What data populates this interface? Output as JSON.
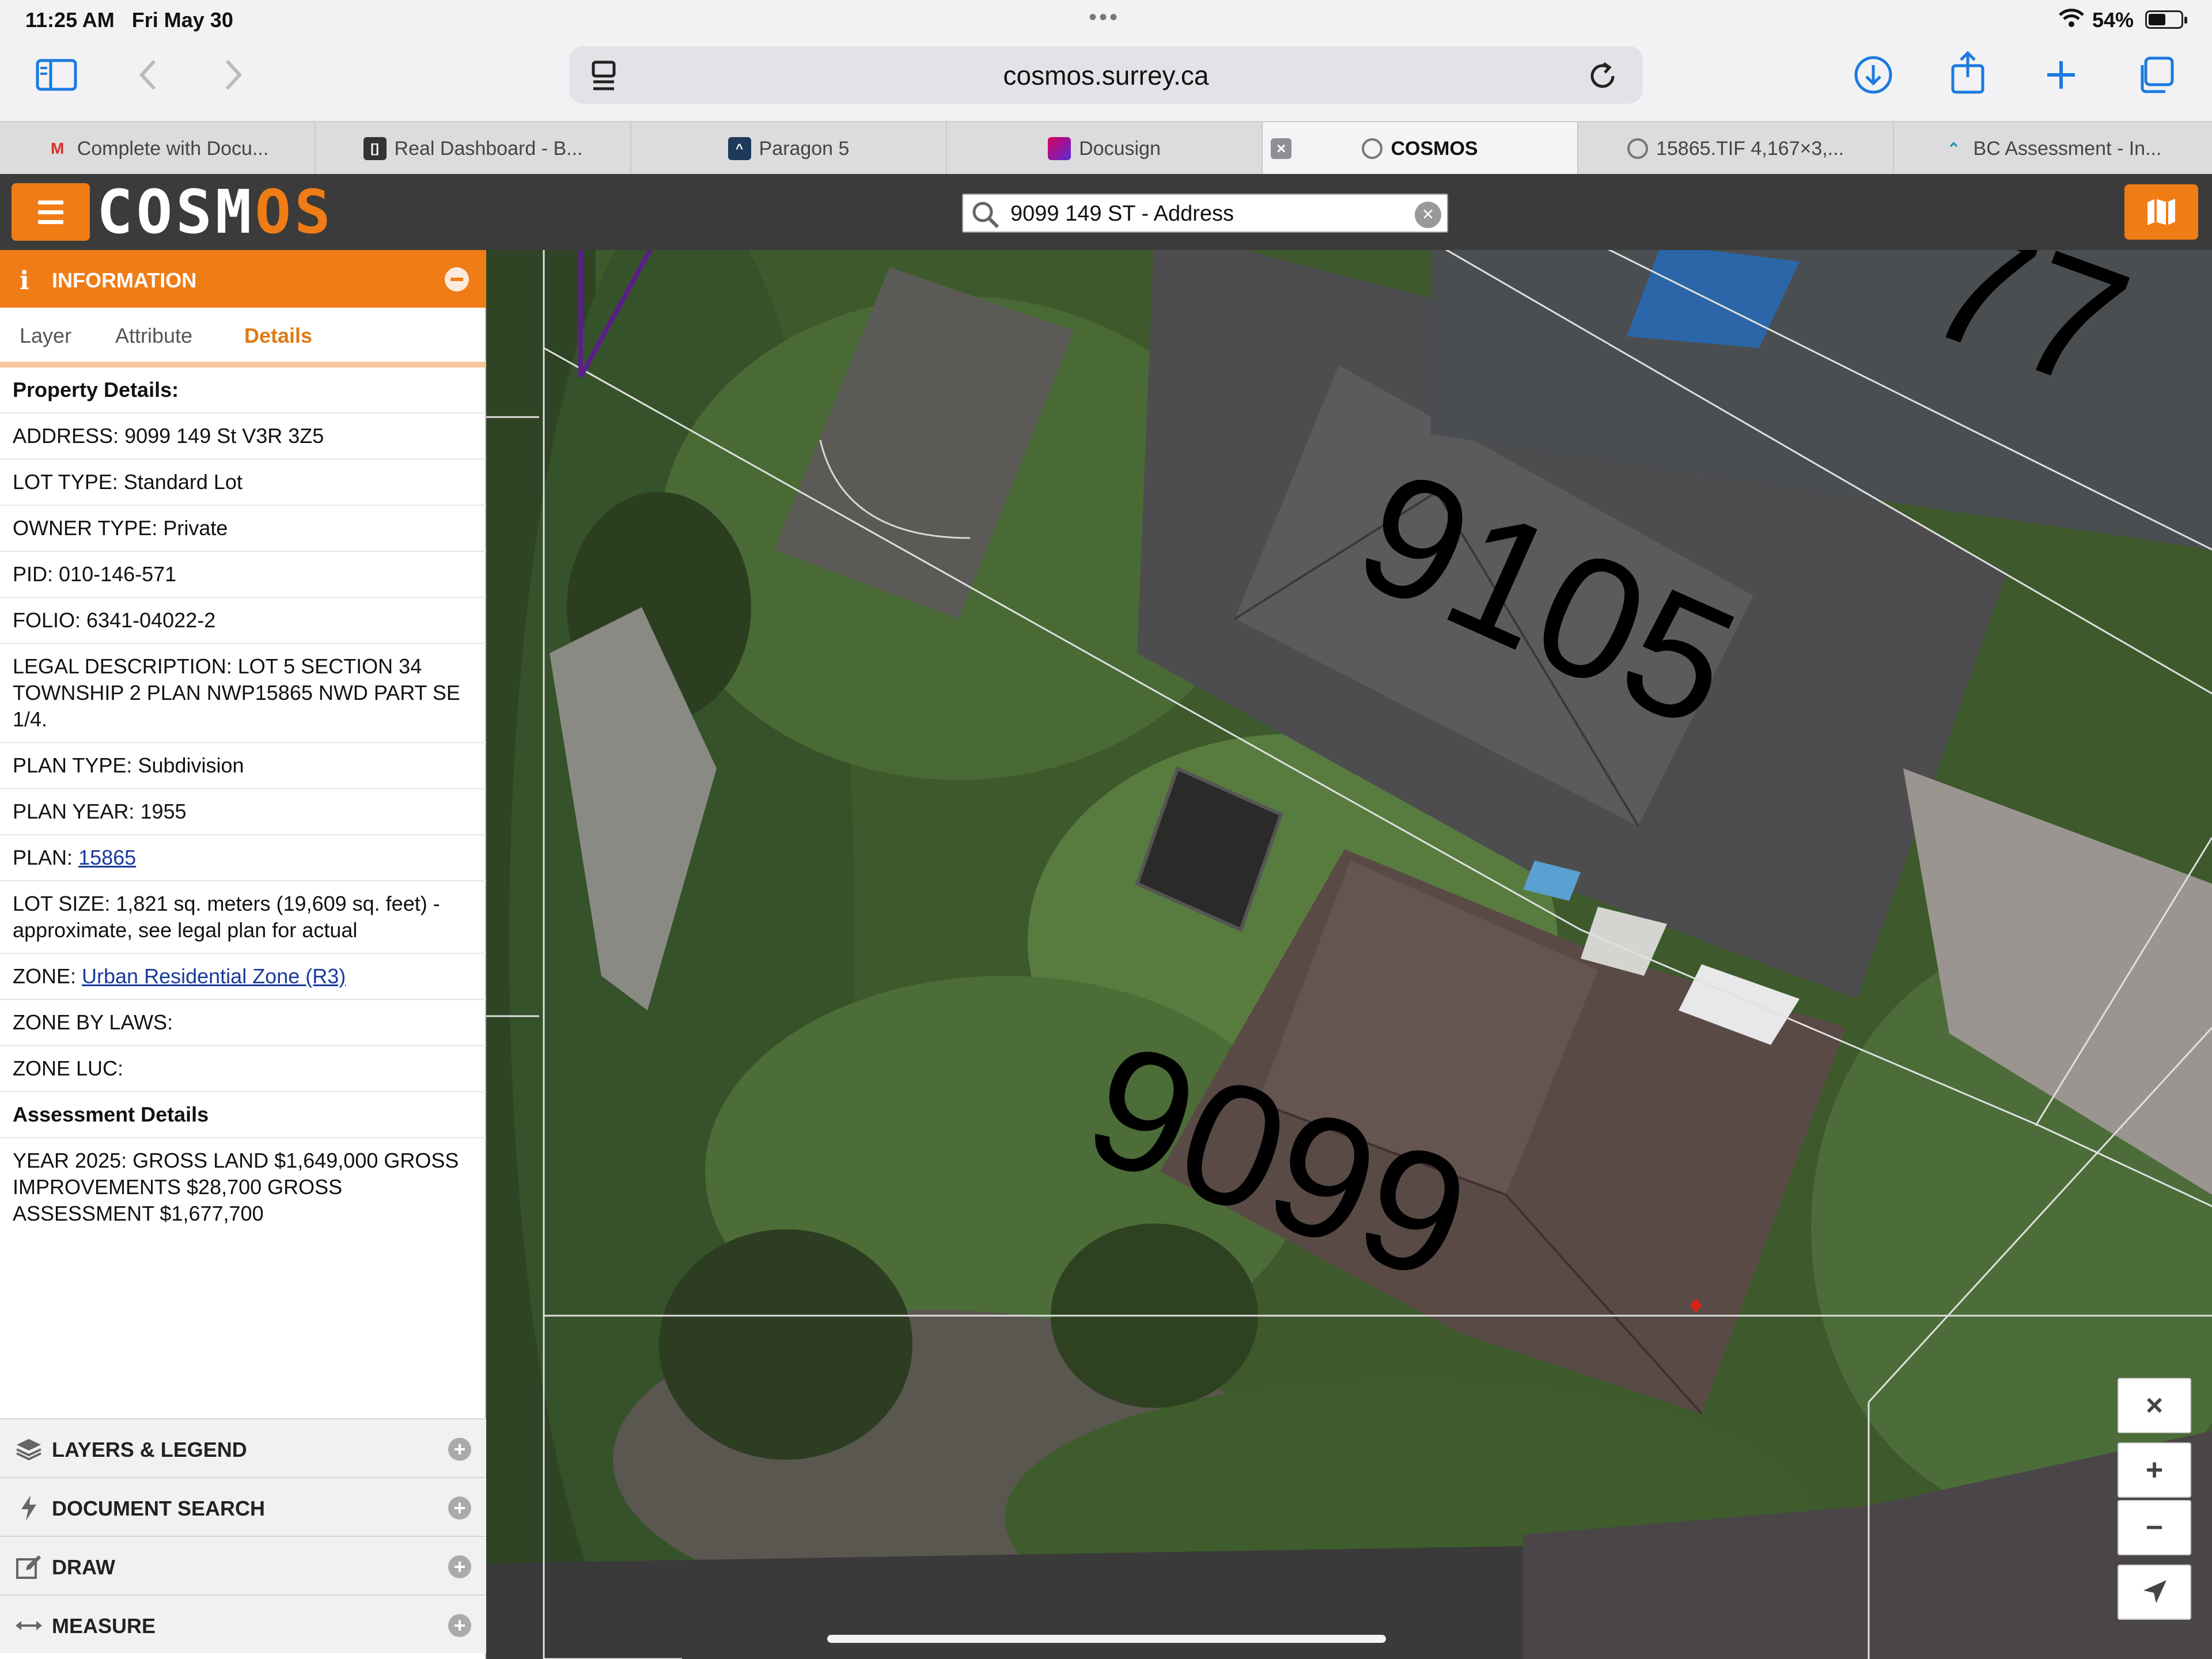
{
  "status_bar": {
    "time": "11:25 AM",
    "date": "Fri May 30",
    "battery_percent": "54%",
    "battery_level": 0.54
  },
  "browser": {
    "url": "cosmos.surrey.ca",
    "tabs": [
      {
        "label": "Complete with Docu...",
        "icon": "gmail-icon"
      },
      {
        "label": "Real Dashboard - B...",
        "icon": "dashboard-icon"
      },
      {
        "label": "Paragon 5",
        "icon": "paragon-icon"
      },
      {
        "label": "Docusign",
        "icon": "docusign-icon"
      },
      {
        "label": "COSMOS",
        "icon": "cosmos-icon",
        "active": true
      },
      {
        "label": "15865.TIF 4,167×3,...",
        "icon": "cosmos-icon"
      },
      {
        "label": "BC Assessment - In...",
        "icon": "bc-assessment-icon"
      }
    ]
  },
  "app": {
    "logo_parts": [
      "COSM",
      "O",
      "S"
    ],
    "search_value": "9099 149 ST - Address",
    "accent_color": "#f07c16"
  },
  "sidebar": {
    "info_title": "INFORMATION",
    "tabs": [
      "Layer",
      "Attribute",
      "Details"
    ],
    "active_tab": "Details",
    "property_heading": "Property Details",
    "rows": [
      {
        "label": "ADDRESS:",
        "value": "9099 149 St V3R 3Z5"
      },
      {
        "label": "LOT TYPE:",
        "value": "Standard Lot"
      },
      {
        "label": "OWNER TYPE:",
        "value": "Private"
      },
      {
        "label": "PID:",
        "value": "010-146-571"
      },
      {
        "label": "FOLIO:",
        "value": "6341-04022-2"
      },
      {
        "label": "LEGAL DESCRIPTION:",
        "value": "LOT 5 SECTION 34 TOWNSHIP 2 PLAN NWP15865 NWD PART SE 1/4."
      },
      {
        "label": "PLAN TYPE:",
        "value": "Subdivision"
      },
      {
        "label": "PLAN YEAR:",
        "value": "1955"
      },
      {
        "label": "PLAN:",
        "value": "15865",
        "link": true
      },
      {
        "label": "LOT SIZE:",
        "value": "1,821 sq. meters (19,609 sq. feet) - approximate, see legal plan for actual"
      },
      {
        "label": "ZONE:",
        "value": "Urban Residential Zone (R3)",
        "link": true
      },
      {
        "label": "ZONE BY LAWS:",
        "value": ""
      },
      {
        "label": "ZONE LUC:",
        "value": ""
      }
    ],
    "assessment_heading": "Assessment Details",
    "assessment_text": "YEAR 2025: GROSS LAND $1,649,000 GROSS IMPROVEMENTS $28,700 GROSS ASSESSMENT $1,677,700",
    "accordions": [
      {
        "label": "LAYERS & LEGEND",
        "icon": "layers-icon"
      },
      {
        "label": "DOCUMENT SEARCH",
        "icon": "bolt-icon"
      },
      {
        "label": "DRAW",
        "icon": "edit-icon"
      },
      {
        "label": "MEASURE",
        "icon": "measure-icon"
      }
    ]
  },
  "map": {
    "labels": [
      "9105",
      "9099",
      "77"
    ],
    "controls": [
      {
        "name": "close",
        "symbol": "×"
      },
      {
        "name": "zoom-in",
        "symbol": "+"
      },
      {
        "name": "zoom-out",
        "symbol": "−"
      },
      {
        "name": "locate",
        "symbol": "➤"
      }
    ]
  }
}
